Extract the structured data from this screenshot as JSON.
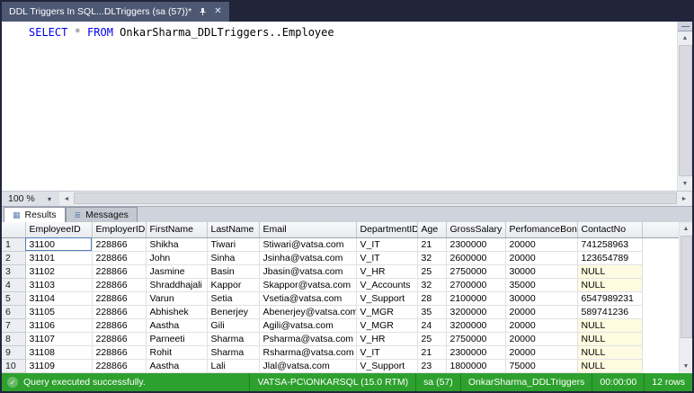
{
  "window": {
    "tab_title": "DDL Triggers In SQL...DLTriggers (sa (57))*"
  },
  "editor": {
    "sql": {
      "select_keyword": "SELECT",
      "star": " * ",
      "from_keyword": "FROM",
      "table_ref": " OnkarSharma_DDLTriggers..Employee"
    },
    "zoom_level": "100 %"
  },
  "results_pane": {
    "tabs": [
      {
        "label": "Results"
      },
      {
        "label": "Messages"
      }
    ]
  },
  "grid": {
    "columns": [
      "EmployeeID",
      "EmployerID",
      "FirstName",
      "LastName",
      "Email",
      "DepartmentID",
      "Age",
      "GrossSalary",
      "PerfomanceBonus",
      "ContactNo"
    ],
    "null_text": "NULL",
    "selected_cell": {
      "row": 0,
      "col": 0
    },
    "rows": [
      {
        "n": "1",
        "cells": [
          "31100",
          "228866",
          "Shikha",
          "Tiwari",
          "Stiwari@vatsa.com",
          "V_IT",
          "21",
          "2300000",
          "20000",
          "741258963"
        ]
      },
      {
        "n": "2",
        "cells": [
          "31101",
          "228866",
          "John",
          "Sinha",
          "Jsinha@vatsa.com",
          "V_IT",
          "32",
          "2600000",
          "20000",
          "123654789"
        ]
      },
      {
        "n": "3",
        "cells": [
          "31102",
          "228866",
          "Jasmine",
          "Basin",
          "Jbasin@vatsa.com",
          "V_HR",
          "25",
          "2750000",
          "30000",
          "NULL"
        ]
      },
      {
        "n": "4",
        "cells": [
          "31103",
          "228866",
          "Shraddhajali",
          "Kappor",
          "Skappor@vatsa.com",
          "V_Accounts",
          "32",
          "2700000",
          "35000",
          "NULL"
        ]
      },
      {
        "n": "5",
        "cells": [
          "31104",
          "228866",
          "Varun",
          "Setia",
          "Vsetia@vatsa.com",
          "V_Support",
          "28",
          "2100000",
          "30000",
          "6547989231"
        ]
      },
      {
        "n": "6",
        "cells": [
          "31105",
          "228866",
          "Abhishek",
          "Benerjey",
          "Abenerjey@vatsa.com",
          "V_MGR",
          "35",
          "3200000",
          "20000",
          "589741236"
        ]
      },
      {
        "n": "7",
        "cells": [
          "31106",
          "228866",
          "Aastha",
          "Gili",
          "Agili@vatsa.com",
          "V_MGR",
          "24",
          "3200000",
          "20000",
          "NULL"
        ]
      },
      {
        "n": "8",
        "cells": [
          "31107",
          "228866",
          "Parneeti",
          "Sharma",
          "Psharma@vatsa.com",
          "V_HR",
          "25",
          "2750000",
          "20000",
          "NULL"
        ]
      },
      {
        "n": "9",
        "cells": [
          "31108",
          "228866",
          "Rohit",
          "Sharma",
          "Rsharma@vatsa.com",
          "V_IT",
          "21",
          "2300000",
          "20000",
          "NULL"
        ]
      },
      {
        "n": "10",
        "cells": [
          "31109",
          "228866",
          "Aastha",
          "Lali",
          "Jlal@vatsa.com",
          "V_Support",
          "23",
          "1800000",
          "75000",
          "NULL"
        ]
      }
    ]
  },
  "status_bar": {
    "message": "Query executed successfully.",
    "server": "VATSA-PC\\ONKARSQL (15.0 RTM)",
    "user": "sa (57)",
    "database": "OnkarSharma_DDLTriggers",
    "time": "00:00:00",
    "row_count": "12 rows"
  },
  "icons": {
    "close": "✕",
    "check": "✓",
    "zoom_chevron": "▾",
    "arrow_up": "▲",
    "arrow_down": "▼",
    "arrow_left": "◄",
    "arrow_right": "►",
    "results_grid": "▦",
    "messages": "≣"
  },
  "colors": {
    "status_green": "#2da02d",
    "kw_blue": "#0000ee",
    "null_yellow": "#fffbe1"
  }
}
